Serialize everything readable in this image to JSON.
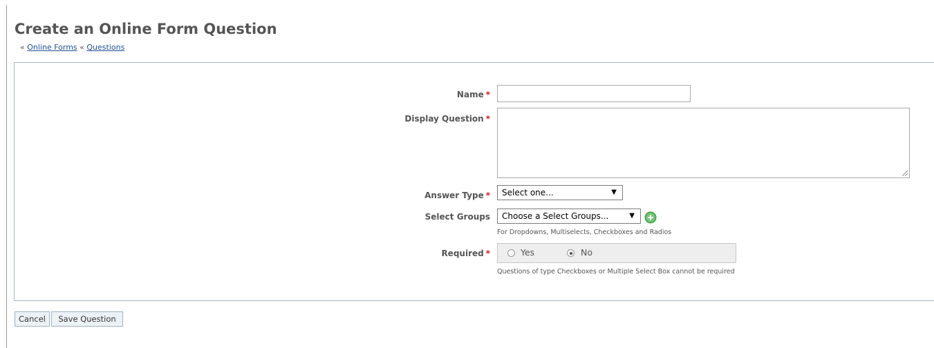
{
  "header": {
    "title": "Create an Online Form Question",
    "breadcrumb_sep": "«",
    "breadcrumb_links": [
      "Online Forms",
      "Questions"
    ]
  },
  "form": {
    "name": {
      "label": "Name",
      "required_marker": "*",
      "value": ""
    },
    "display_question": {
      "label": "Display Question",
      "required_marker": "*",
      "value": ""
    },
    "answer_type": {
      "label": "Answer Type",
      "required_marker": "*",
      "selected": "Select one..."
    },
    "select_groups": {
      "label": "Select Groups",
      "selected": "Choose a Select Groups...",
      "hint": "For Dropdowns, Multiselects, Checkboxes and Radios",
      "add_icon": "plus-circle-icon"
    },
    "required": {
      "label": "Required",
      "required_marker": "*",
      "options": [
        "Yes",
        "No"
      ],
      "selected": "No",
      "hint": "Questions of type Checkboxes or Multiple Select Box cannot be required"
    }
  },
  "actions": {
    "cancel_label": "Cancel",
    "save_label": "Save Question"
  },
  "colors": {
    "title": "#555555",
    "link": "#1f4e9a",
    "required": "#c81e1e",
    "add_icon": "#5cb85c",
    "panel_border": "#a9b6c0"
  }
}
